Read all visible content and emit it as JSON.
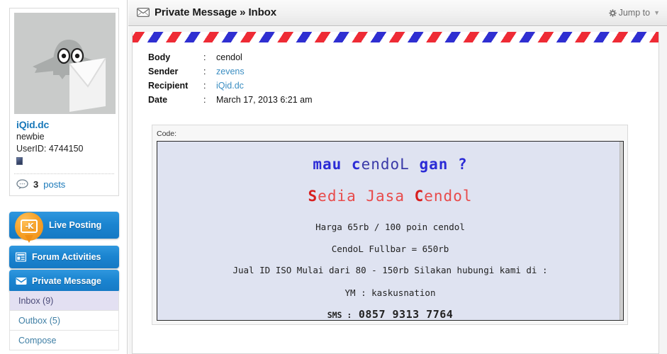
{
  "header": {
    "title": "Private Message » Inbox",
    "envelope_icon": "envelope-icon",
    "jump_to_label": "Jump to",
    "gear_icon": "gear-icon",
    "caret_icon": "chevron-down-icon"
  },
  "sidebar": {
    "profile": {
      "avatar_icon": "avatar-ghost-envelope",
      "username": "iQid.dc",
      "rank": "newbie",
      "userid": "UserID: 4744150",
      "badge_icon": "rank-badge-icon",
      "posts_icon": "speech-bubble-icon",
      "posts_count": "3",
      "posts_label": "posts"
    },
    "buttons": [
      {
        "label": "Live Posting",
        "icon": "live-posting-pin-icon"
      },
      {
        "label": "Forum Activities",
        "icon": "forum-grid-icon"
      },
      {
        "label": "Private Message",
        "icon": "envelope-icon"
      }
    ],
    "subitems": [
      {
        "label": "Inbox (9)",
        "active": true
      },
      {
        "label": "Outbox (5)",
        "active": false
      },
      {
        "label": "Compose",
        "active": false
      }
    ]
  },
  "message": {
    "fields": [
      {
        "label": "Body",
        "colon": ":",
        "value": "cendol",
        "link": false
      },
      {
        "label": "Sender",
        "colon": ":",
        "value": "zevens",
        "link": true
      },
      {
        "label": "Recipient",
        "colon": ":",
        "value": "iQid.dc",
        "link": true
      },
      {
        "label": "Date",
        "colon": ":",
        "value": "March 17, 2013 6:21 am",
        "link": false
      }
    ],
    "code_label": "Code:",
    "code": {
      "line1_a": "m",
      "line1_b": "au ",
      "line1_c": "c",
      "line1_d": "endoL ",
      "line1_e": "gan",
      "line1_f": " ?",
      "line2_a": "S",
      "line2_b": "edia Jasa ",
      "line2_c": "C",
      "line2_d": "endol",
      "line3": "Harga 65rb / 100 poin cendol",
      "line4": "CendoL Fullbar = 650rb",
      "line5": "Jual ID ISO Mulai dari 80 - 150rb Silakan hubungi kami di  :",
      "line6": "YM :  kaskusnation",
      "line7_label": "SMS :",
      "line7_number": "0857 9313 7764"
    }
  },
  "colors": {
    "accent_blue": "#1a84d0",
    "link_blue": "#3b8ec2",
    "code_bg": "#dfe3f1",
    "airmail_red": "#ee2b35",
    "airmail_blue": "#2f2fd1",
    "active_subitem": "#e3e0f2",
    "pin_orange": "#ef8f16"
  }
}
